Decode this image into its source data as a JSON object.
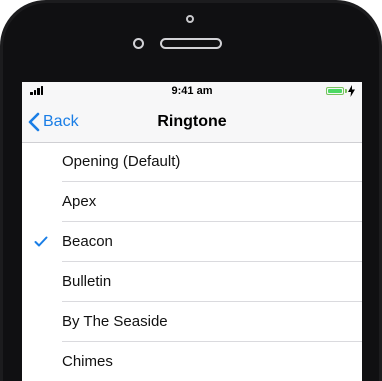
{
  "status_bar": {
    "time": "9:41 am",
    "signal_icon": "signal-bars-icon",
    "battery_icon": "battery-charging-icon"
  },
  "nav_bar": {
    "back_label": "Back",
    "back_icon": "chevron-left-icon",
    "title": "Ringtone"
  },
  "ringtones": [
    {
      "label": "Opening (Default)",
      "selected": false
    },
    {
      "label": "Apex",
      "selected": false
    },
    {
      "label": "Beacon",
      "selected": true
    },
    {
      "label": "Bulletin",
      "selected": false
    },
    {
      "label": "By The Seaside",
      "selected": false
    },
    {
      "label": "Chimes",
      "selected": false
    }
  ],
  "colors": {
    "accent": "#1a7ee6",
    "battery": "#4cd964",
    "device_frame": "#1c1c1e"
  }
}
